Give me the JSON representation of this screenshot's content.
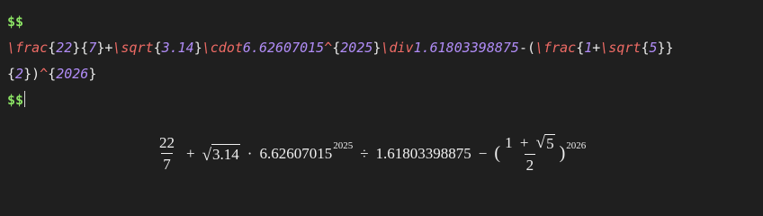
{
  "editor": {
    "line1": "$$",
    "line2_parts": [
      {
        "t": "\\frac",
        "c": "cmd"
      },
      {
        "t": "{",
        "c": "brace"
      },
      {
        "t": "22",
        "c": "num"
      },
      {
        "t": "}",
        "c": "brace"
      },
      {
        "t": "{",
        "c": "brace"
      },
      {
        "t": "7",
        "c": "num"
      },
      {
        "t": "}",
        "c": "brace"
      },
      {
        "t": "+",
        "c": "op"
      },
      {
        "t": "\\sqrt",
        "c": "cmd"
      },
      {
        "t": "{",
        "c": "brace"
      },
      {
        "t": "3.14",
        "c": "num"
      },
      {
        "t": "}",
        "c": "brace"
      },
      {
        "t": "\\cdot",
        "c": "cmd"
      },
      {
        "t": "6.62607015",
        "c": "num"
      },
      {
        "t": "^",
        "c": "cmd"
      },
      {
        "t": "{",
        "c": "brace"
      },
      {
        "t": "2025",
        "c": "num"
      },
      {
        "t": "}",
        "c": "brace"
      },
      {
        "t": "\\div",
        "c": "cmd"
      },
      {
        "t": "1.61803398875",
        "c": "num"
      },
      {
        "t": "-(",
        "c": "op"
      },
      {
        "t": "\\frac",
        "c": "cmd"
      },
      {
        "t": "{",
        "c": "brace"
      },
      {
        "t": "1",
        "c": "num"
      },
      {
        "t": "+",
        "c": "op"
      },
      {
        "t": "\\sqrt",
        "c": "cmd"
      },
      {
        "t": "{",
        "c": "brace"
      },
      {
        "t": "5",
        "c": "num"
      },
      {
        "t": "}}",
        "c": "brace"
      }
    ],
    "line3_parts": [
      {
        "t": "{",
        "c": "brace"
      },
      {
        "t": "2",
        "c": "num"
      },
      {
        "t": "})",
        "c": "brace"
      },
      {
        "t": "^",
        "c": "cmd"
      },
      {
        "t": "{",
        "c": "brace"
      },
      {
        "t": "2026",
        "c": "num"
      },
      {
        "t": "}",
        "c": "brace"
      }
    ],
    "line4": "$$"
  },
  "render": {
    "frac1_num": "22",
    "frac1_den": "7",
    "plus1": "+",
    "sqrt1_arg": "3.14",
    "cdot": "·",
    "planck": "6.62607015",
    "exp1": "2025",
    "div": "÷",
    "phi": "1.61803398875",
    "minus": "−",
    "lparen": "(",
    "frac2_num_a": "1",
    "frac2_plus": "+",
    "sqrt2_arg": "5",
    "frac2_den": "2",
    "rparen": ")",
    "exp2": "2026"
  },
  "colors": {
    "background": "#1f1f1f",
    "dollar": "#8be264",
    "command": "#ee6b65",
    "number": "#b08cf6",
    "text": "#e9e9e9"
  }
}
